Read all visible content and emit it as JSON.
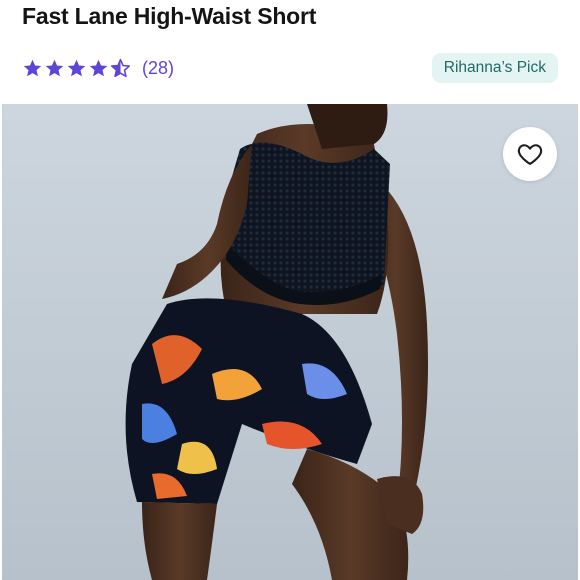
{
  "product": {
    "title": "Fast Lane High-Waist Short",
    "rating": 4.5,
    "rating_max": 5,
    "review_count_label": "(28)",
    "badge": "Rihanna’s Pick"
  },
  "icons": {
    "stars": [
      "star-full-icon",
      "star-full-icon",
      "star-full-icon",
      "star-full-icon",
      "star-half-icon"
    ],
    "favorite": "heart-outline-icon"
  },
  "colors": {
    "star": "#5b46d6",
    "badge_bg": "#e3f4f2",
    "badge_text": "#1f6a66"
  }
}
